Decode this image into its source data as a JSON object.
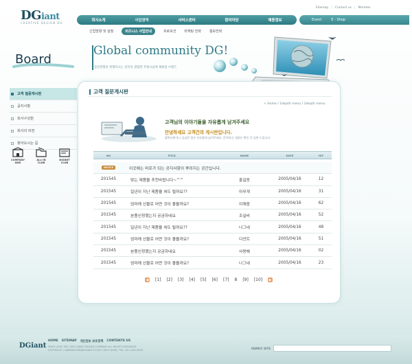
{
  "logo": {
    "main": "DG",
    "main_small": "iant",
    "sub": "CREATIVE DESIGN DG"
  },
  "util_links": [
    "Sitemap",
    "Contact us",
    "Member"
  ],
  "main_nav": [
    "회사소개",
    "사업영역",
    "서비스센터",
    "참여마당",
    "채용정보"
  ],
  "right_nav": [
    "Event",
    "E - Shop"
  ],
  "sub_nav": [
    "신업방향 및 설정",
    "비즈니스 사업안내",
    "프로모션",
    "마케팅 전략",
    "홍보전략"
  ],
  "hero": {
    "title": "Global community DG!",
    "desc": "동반경쟁의 위해하시는 감치의 결합텐 프렌시넘에 재류업 브랜드"
  },
  "board": {
    "title": "Board",
    "side_menu": [
      "고객 질문게시판",
      "공지사항",
      "회사구성원",
      "회사의 비전",
      "찾아오시는 길"
    ],
    "quick_links": [
      {
        "label": "COMPANY ADD",
        "icon": "building-icon"
      },
      {
        "label": "ALL-IN CLUB",
        "icon": "folder-icon"
      },
      {
        "label": "DIGINIT CLUB",
        "icon": "card-icon"
      }
    ]
  },
  "content": {
    "title": "고객 질문게시판",
    "breadcrumb": "+ Home / 1depth menu / 2depth menu",
    "welcome_line1": "고객님의 이야기들을 자유롭게 남겨주세요",
    "welcome_line2": "안녕하세요 고객건의 게시판입니다.",
    "welcome_line3": "불편사항이나 궁금한 점은 자유롭게 남겨주세요. 문의하신 내용은 확인 후 답변 드립니다."
  },
  "table": {
    "headers": [
      "NO",
      "TITLE",
      "NAME",
      "DATE",
      "HIT"
    ],
    "notice": {
      "badge": "NOTICE",
      "title": "이곳에는 머로가 되는 공지사항이 뿌려지는 공간입니다."
    },
    "rows": [
      {
        "no": "201545",
        "title": "맞는 제품을 추천바랍니다~^^",
        "name": "홍길동",
        "date": "2005/04/16",
        "hit": "12"
      },
      {
        "no": "201545",
        "title": "일년이 지난 제품을 쳐도 될까요??",
        "name": "아무개",
        "date": "2005/04/16",
        "hit": "31"
      },
      {
        "no": "201545",
        "title": "엄마께 선물로 어떤 것이 좋을까요?",
        "name": "이재중",
        "date": "2005/04/16",
        "hit": "62"
      },
      {
        "no": "201545",
        "title": "본품신청했는지 궁금하네요",
        "name": "조실비",
        "date": "2005/04/16",
        "hit": "52"
      },
      {
        "no": "201545",
        "title": "일년이 지난 제품을 쳐도 될까요??",
        "name": "나그네",
        "date": "2005/04/16",
        "hit": "48"
      },
      {
        "no": "201545",
        "title": "엄마께 선물로 어떤 것이 좋을까요?",
        "name": "디언트",
        "date": "2005/04/16",
        "hit": "51"
      },
      {
        "no": "201545",
        "title": "본품신청했는지 궁금하네요",
        "name": "사랑해",
        "date": "2005/04/16",
        "hit": "02"
      },
      {
        "no": "201545",
        "title": "엄마께 선물로 어떤 것이 좋을까요?",
        "name": "나그네",
        "date": "2005/04/16",
        "hit": "23"
      }
    ]
  },
  "pager": {
    "prev": "◀",
    "next": "▶",
    "pages": [
      "[1]",
      "[2]",
      "[3]",
      "[4]",
      "[5]",
      "[6]",
      "[7]",
      "8",
      "[9]",
      "[10]"
    ]
  },
  "footer": {
    "logo": "DGiant",
    "links": [
      "HOME",
      "SITEMAP",
      "개인정보 보호정책",
      "CONTENTS US"
    ],
    "copy1": "SINCE 2005 THE 2005 GIANT DESIGN COMPANY ALL RIGHTS RESERVED",
    "copy2": "COPYRIGHT / WEBMASTER@DGIANT.CO.KR / HELP DESK / TEL: 02-1234-5678",
    "family_label": "FAMILY SITE"
  },
  "colors": {
    "accent": "#2a7380",
    "nav": "#3c858c",
    "notice": "#c98a3a",
    "welcome_gold": "#c28b1a"
  }
}
